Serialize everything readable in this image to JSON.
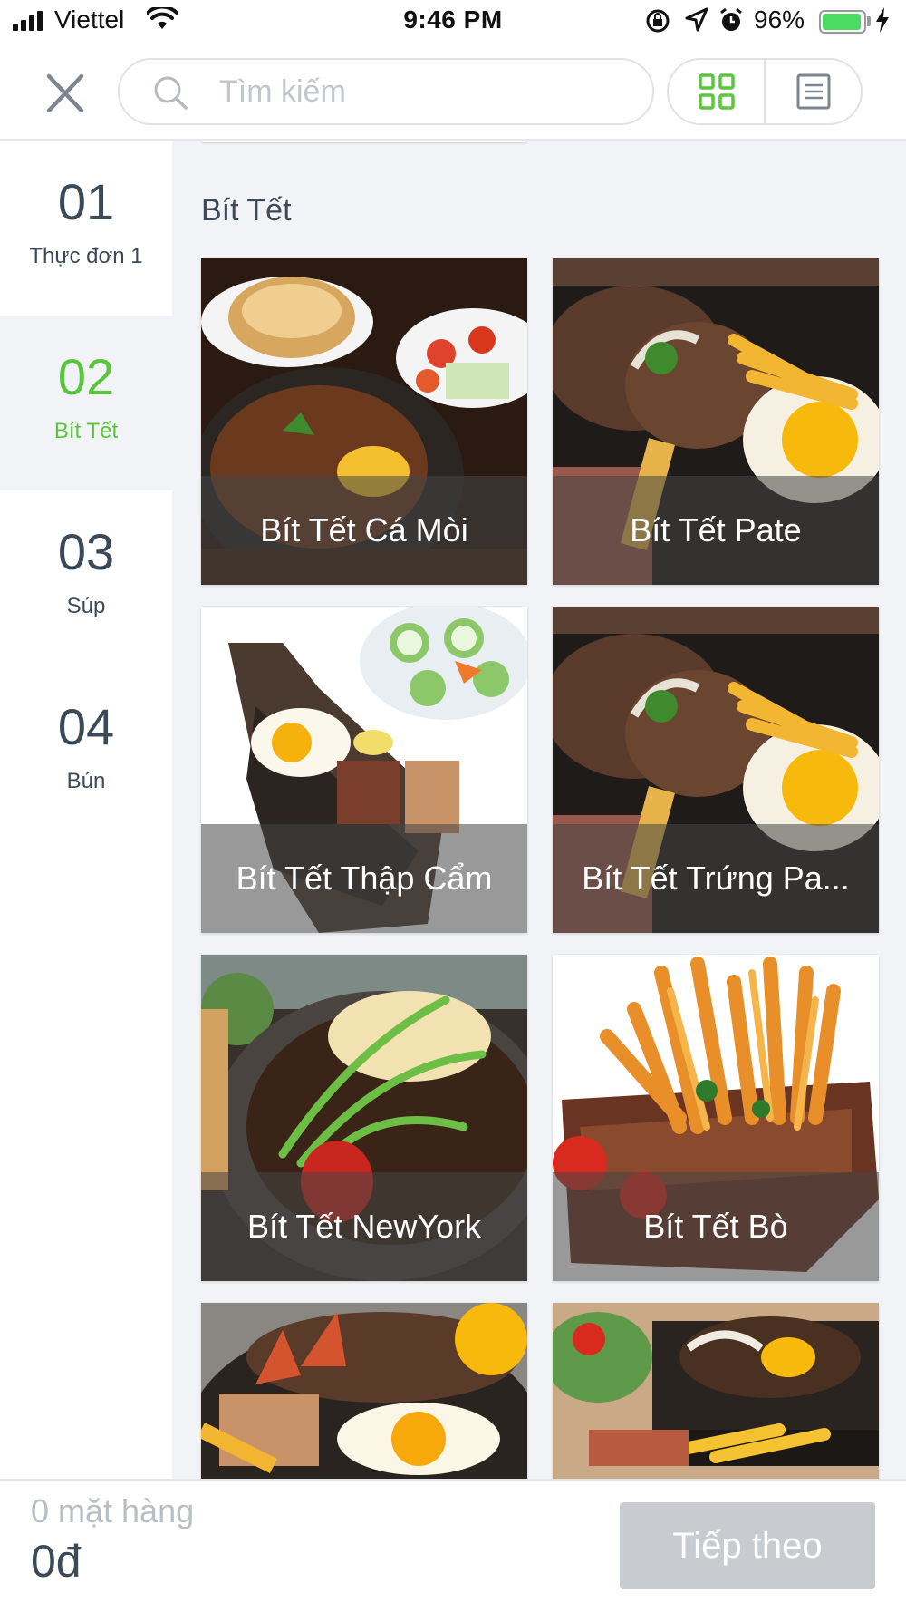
{
  "status_bar": {
    "carrier": "Viettel",
    "time": "9:46 PM",
    "battery_percent": "96%",
    "battery_level": 0.96
  },
  "header": {
    "search_placeholder": "Tìm kiếm",
    "view_mode": "grid"
  },
  "sidebar": {
    "items": [
      {
        "number": "01",
        "label": "Thực đơn 1",
        "active": false
      },
      {
        "number": "02",
        "label": "Bít Tết",
        "active": true
      },
      {
        "number": "03",
        "label": "Súp",
        "active": false
      },
      {
        "number": "04",
        "label": "Bún",
        "active": false
      }
    ]
  },
  "main": {
    "section_title": "Bít Tết",
    "items": [
      {
        "name": "Bít Tết Cá Mòi"
      },
      {
        "name": "Bít Tết Pate"
      },
      {
        "name": "Bít Tết Thập Cẩm"
      },
      {
        "name": "Bít Tết Trứng Pa..."
      },
      {
        "name": "Bít Tết NewYork"
      },
      {
        "name": "Bít Tết Bò"
      },
      {
        "name": ""
      },
      {
        "name": ""
      }
    ]
  },
  "footer": {
    "item_count": "0 mặt hàng",
    "total": "0đ",
    "next_label": "Tiếp theo"
  },
  "colors": {
    "accent": "#5ac53d",
    "text": "#3c4a57",
    "panel_bg": "#f1f3f6",
    "button_disabled": "#c8cbcf"
  },
  "icons": [
    "signal-icon",
    "wifi-icon",
    "rotation-lock-icon",
    "location-icon",
    "alarm-icon",
    "battery-icon",
    "charging-icon",
    "close-icon",
    "search-icon",
    "grid-view-icon",
    "list-view-icon"
  ]
}
